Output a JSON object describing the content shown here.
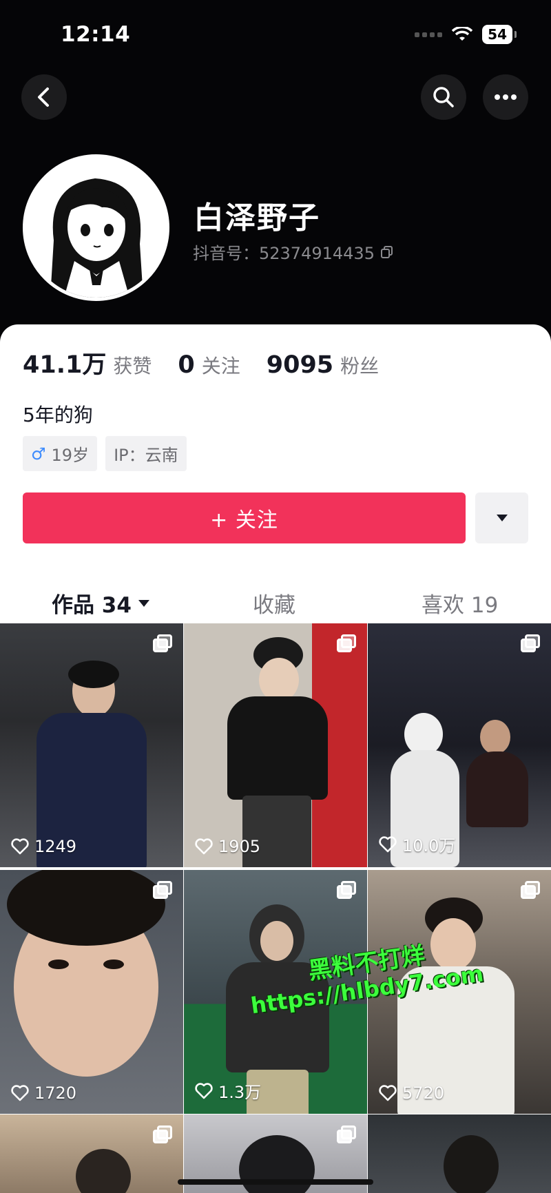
{
  "status_bar": {
    "time": "12:14",
    "battery": "54"
  },
  "profile": {
    "username": "白泽野子",
    "douyin_id": "抖音号：52374914435",
    "stats": [
      {
        "value": "41.1万",
        "label": "获赞"
      },
      {
        "value": "0",
        "label": "关注"
      },
      {
        "value": "9095",
        "label": "粉丝"
      }
    ],
    "bio": "5年的狗",
    "tags": {
      "gender_symbol": "♂",
      "age": "19岁",
      "ip": "IP：云南"
    }
  },
  "actions": {
    "follow_label": "+ 关注"
  },
  "tabs": [
    {
      "label": "作品 34"
    },
    {
      "label": "收藏"
    },
    {
      "label": "喜欢 19"
    }
  ],
  "posts": [
    {
      "likes": "1249"
    },
    {
      "likes": "1905"
    },
    {
      "likes": "10.0万"
    },
    {
      "likes": "1720"
    },
    {
      "likes": "1.3万"
    },
    {
      "likes": "5720"
    }
  ],
  "watermark": {
    "line1": "黑料不打烊",
    "line2": "https://hlbdy7.com"
  },
  "colors": {
    "accent": "#f2325a",
    "header_bg": "#050507",
    "watermark": "#3cff3c"
  }
}
